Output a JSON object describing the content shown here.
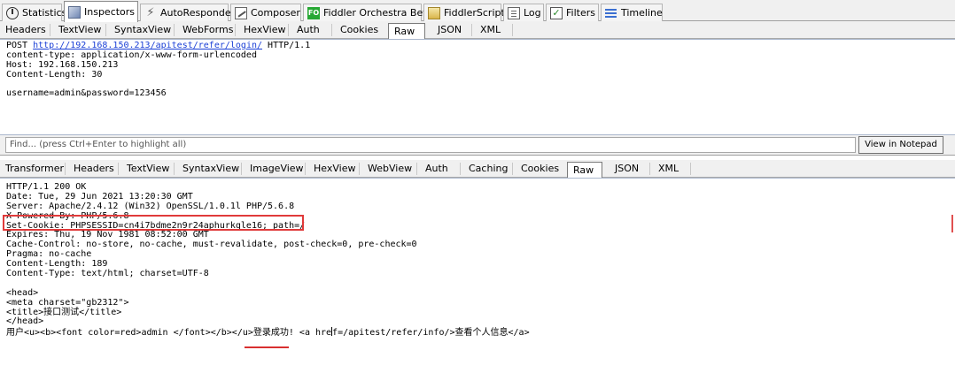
{
  "main_tabs": [
    {
      "label": "Statistics",
      "icon": "statistics-icon"
    },
    {
      "label": "Inspectors",
      "icon": "inspectors-icon"
    },
    {
      "label": "AutoResponder",
      "icon": "lightning-icon"
    },
    {
      "label": "Composer",
      "icon": "compose-icon"
    },
    {
      "label": "Fiddler Orchestra Beta",
      "icon": "fiddler-orchestra-icon"
    },
    {
      "label": "FiddlerScript",
      "icon": "script-icon"
    },
    {
      "label": "Log",
      "icon": "log-icon"
    },
    {
      "label": "Filters",
      "icon": "filter-checkbox-icon"
    },
    {
      "label": "Timeline",
      "icon": "timeline-icon"
    }
  ],
  "fo_icon_text": "FO",
  "request": {
    "tabs": [
      "Headers",
      "TextView",
      "SyntaxView",
      "WebForms",
      "HexView",
      "Auth",
      "Cookies",
      "Raw",
      "JSON",
      "XML"
    ],
    "active_tab": "Raw",
    "method": "POST",
    "url": "http://192.168.150.213/apitest/refer/login/",
    "protocol": "HTTP/1.1",
    "headers": [
      "content-type: application/x-www-form-urlencoded",
      "Host: 192.168.150.213",
      "Content-Length: 30"
    ],
    "body": "username=admin&password=123456"
  },
  "find": {
    "placeholder": "Find... (press Ctrl+Enter to highlight all)",
    "button_label": "View in Notepad"
  },
  "response": {
    "tabs": [
      "Transformer",
      "Headers",
      "TextView",
      "SyntaxView",
      "ImageView",
      "HexView",
      "WebView",
      "Auth",
      "Caching",
      "Cookies",
      "Raw",
      "JSON",
      "XML"
    ],
    "active_tab": "Raw",
    "lines": [
      "HTTP/1.1 200 OK",
      "Date: Tue, 29 Jun 2021 13:20:30 GMT",
      "Server: Apache/2.4.12 (Win32) OpenSSL/1.0.1l PHP/5.6.8",
      "X-Powered-By: PHP/5.6.8",
      "Set-Cookie: PHPSESSID=cn4i7bdme2n9r24aphurkqle16; path=/",
      "Expires: Thu, 19 Nov 1981 08:52:00 GMT",
      "Cache-Control: no-store, no-cache, must-revalidate, post-check=0, pre-check=0",
      "Pragma: no-cache",
      "Content-Length: 189",
      "Content-Type: text/html; charset=UTF-8",
      "",
      "<head>",
      "<meta charset=\"gb2312\">",
      "<title>接口测试</title>",
      "</head>"
    ],
    "body_line_before_caret": "用户<u><b><font color=red>admin </font></b></u>登录成功! <a hre",
    "body_line_after_caret": "f=/apitest/refer/info/>查看个人信息</a>"
  }
}
